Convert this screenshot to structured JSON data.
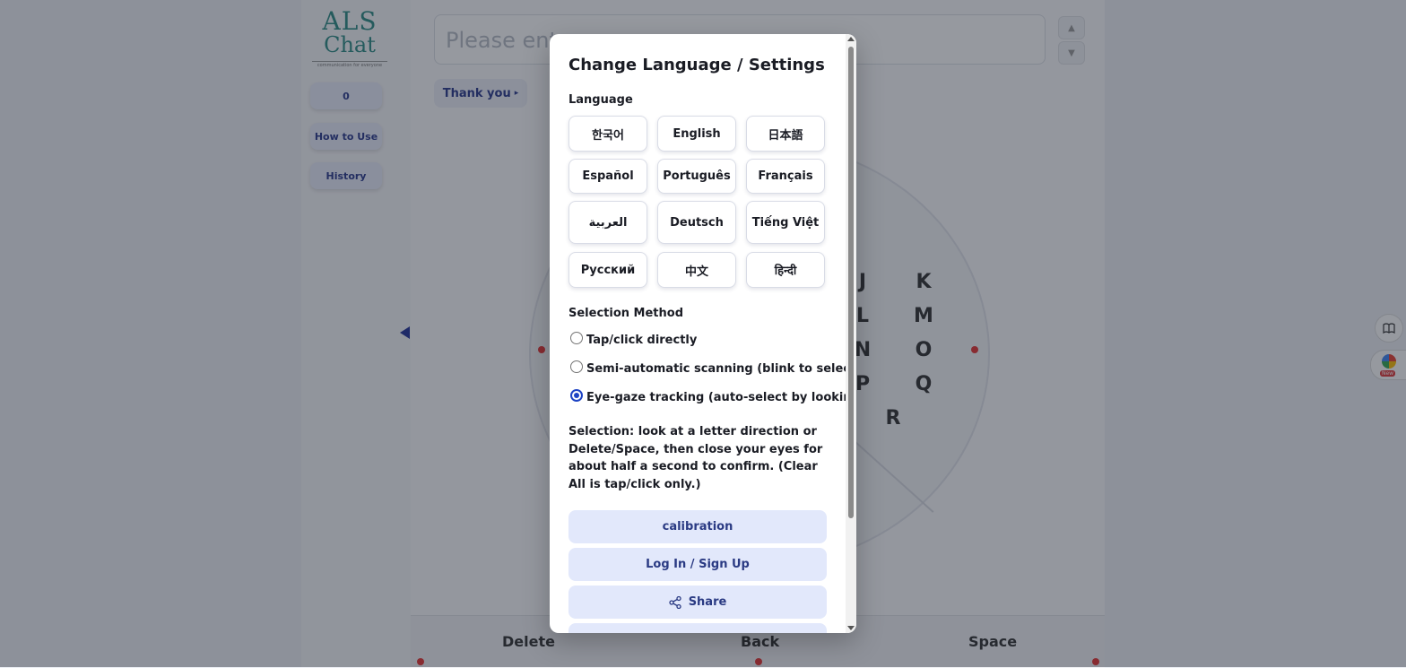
{
  "background": {
    "logo": {
      "line1": "ALS",
      "line2": "Chat",
      "tagline": "communication for everyone"
    },
    "sidebar": [
      {
        "label": "0"
      },
      {
        "label": "How to Use"
      },
      {
        "label": "History"
      }
    ],
    "input_placeholder": "Please ente",
    "phrase_chip": "Thank you",
    "wheel_letters": [
      "J",
      "K",
      "L",
      "M",
      "N",
      "O",
      "P",
      "Q",
      "R"
    ],
    "bottom_keys": [
      "Delete",
      "Back",
      "Space"
    ],
    "new_badge": "New"
  },
  "modal": {
    "title": "Change Language / Settings",
    "language_label": "Language",
    "languages": [
      "한국어",
      "English",
      "日本語",
      "Español",
      "Português",
      "Français",
      "العربية",
      "Deutsch",
      "Tiếng Việt",
      "Русский",
      "中文",
      "हिन्दी"
    ],
    "selection_label": "Selection Method",
    "methods": [
      {
        "label": "Tap/click directly",
        "checked": false
      },
      {
        "label": "Semi-automatic scanning (blink to select)",
        "checked": false
      },
      {
        "label": "Eye-gaze tracking (auto-select by looking)",
        "checked": true
      }
    ],
    "info": "Selection: look at a letter direction or Delete/Space, then close your eyes for about half a second to confirm. (Clear All is tap/click only.)",
    "buttons": {
      "calibration": "calibration",
      "login": "Log In / Sign Up",
      "share": "Share"
    }
  },
  "colors": {
    "accent": "#1d43c4",
    "button_bg": "#e2e8fb",
    "button_text": "#2a3a83",
    "dot": "#e53535"
  }
}
